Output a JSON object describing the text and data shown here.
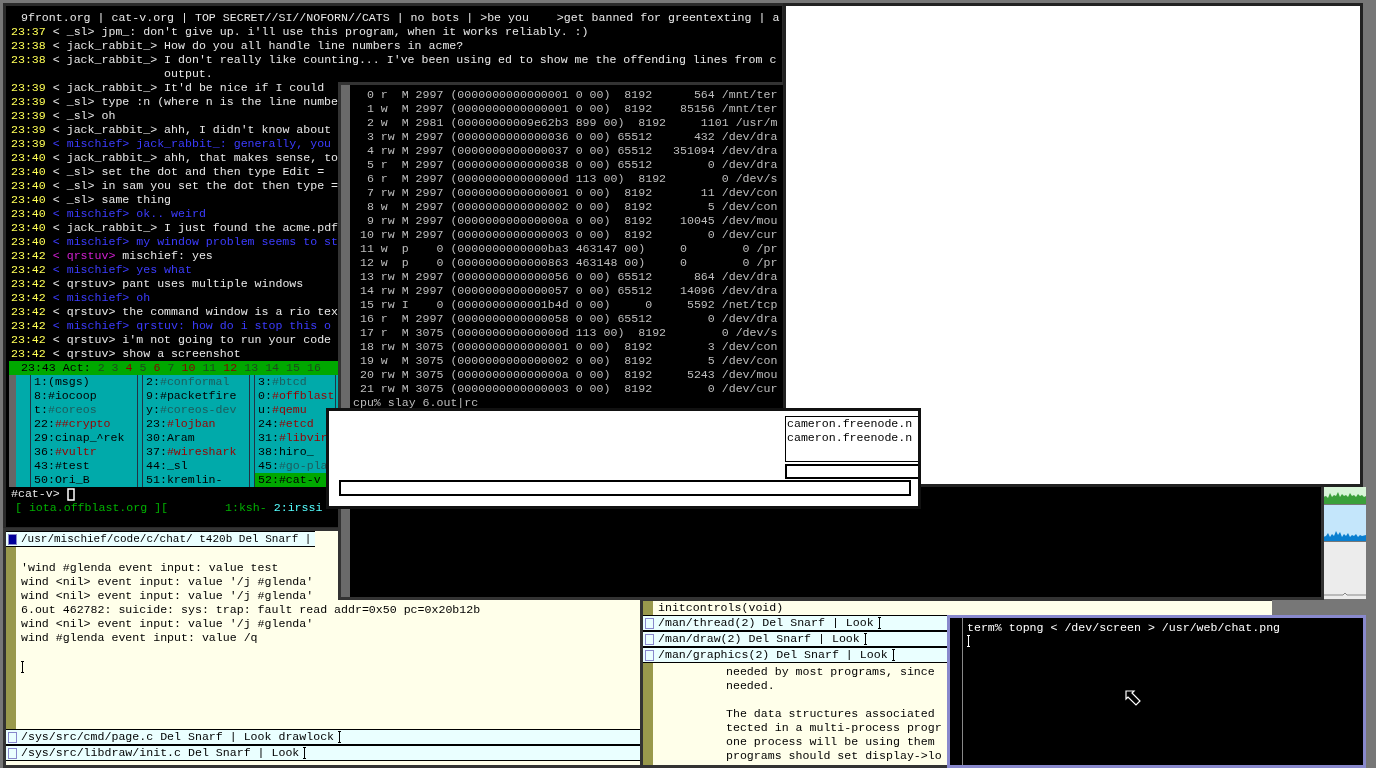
{
  "irc": {
    "topic": "9front.org | cat-v.org | TOP SECRET//SI//NOFORN//CATS | no bots | >be you    >get banned for greentexting | a",
    "lines": [
      {
        "kind": "normal",
        "time": "23:37",
        "nick": "< _sl>",
        "text": "jpm_: don't give up. i'll use this program, when it works reliably. :)"
      },
      {
        "kind": "normal",
        "time": "23:38",
        "nick": "< jack_rabbit_>",
        "text": "How do you all handle line numbers in acme?"
      },
      {
        "kind": "normal",
        "time": "23:38",
        "nick": "< jack_rabbit_>",
        "text": "I don't really like counting... I've been using ed to show me the offending lines from c"
      },
      {
        "kind": "wrap",
        "text": "output."
      },
      {
        "kind": "normal",
        "time": "23:39",
        "nick": "< jack_rabbit_>",
        "text": "It'd be nice if I could"
      },
      {
        "kind": "normal",
        "time": "23:39",
        "nick": "< _sl>",
        "text": "type :n (where n is the line numbe"
      },
      {
        "kind": "normal",
        "time": "23:39",
        "nick": "< _sl>",
        "text": "oh"
      },
      {
        "kind": "normal",
        "time": "23:39",
        "nick": "< jack_rabbit_>",
        "text": "ahh, I didn't know about"
      },
      {
        "kind": "own",
        "time": "23:39",
        "nick": "< mischief>",
        "text": "jack_rabbit_: generally, you"
      },
      {
        "kind": "normal",
        "time": "23:40",
        "nick": "< jack_rabbit_>",
        "text": "ahh, that makes sense, to"
      },
      {
        "kind": "normal",
        "time": "23:40",
        "nick": "< _sl>",
        "text": "set the dot and then type Edit ="
      },
      {
        "kind": "normal",
        "time": "23:40",
        "nick": "< _sl>",
        "text": "in sam you set the dot then type ="
      },
      {
        "kind": "normal",
        "time": "23:40",
        "nick": "< _sl>",
        "text": "same thing"
      },
      {
        "kind": "own",
        "time": "23:40",
        "nick": "< mischief>",
        "text": "ok.. weird"
      },
      {
        "kind": "normal",
        "time": "23:40",
        "nick": "< jack_rabbit_>",
        "text": "I just found the acme.pdf"
      },
      {
        "kind": "own",
        "time": "23:40",
        "nick": "< mischief>",
        "text": "my window problem seems to st"
      },
      {
        "kind": "mention",
        "time": "23:42",
        "nick": "< qrstuv>",
        "text": "mischief: yes"
      },
      {
        "kind": "own",
        "time": "23:42",
        "nick": "< mischief>",
        "text": "yes what"
      },
      {
        "kind": "normal",
        "time": "23:42",
        "nick": "< qrstuv>",
        "text": "pant uses multiple windows"
      },
      {
        "kind": "own",
        "time": "23:42",
        "nick": "< mischief>",
        "text": "oh"
      },
      {
        "kind": "normal",
        "time": "23:42",
        "nick": "< qrstuv>",
        "text": "the command window is a rio tex"
      },
      {
        "kind": "own",
        "time": "23:42",
        "nick": "< mischief>",
        "text": "qrstuv: how do i stop this o"
      },
      {
        "kind": "normal",
        "time": "23:42",
        "nick": "< qrstuv>",
        "text": "i'm not going to run your code"
      },
      {
        "kind": "normal",
        "time": "23:42",
        "nick": "< qrstuv>",
        "text": "show a screenshot"
      }
    ],
    "status": {
      "clock": "23:43",
      "label": "Act:",
      "activity": [
        {
          "label": "2",
          "alert": false
        },
        {
          "label": "3",
          "alert": false
        },
        {
          "label": "4",
          "alert": true
        },
        {
          "label": "5",
          "alert": false
        },
        {
          "label": "6",
          "alert": true
        },
        {
          "label": "7",
          "alert": false
        },
        {
          "label": "10",
          "alert": true
        },
        {
          "label": "11",
          "alert": false
        },
        {
          "label": "12",
          "alert": true
        },
        {
          "label": "13",
          "alert": false
        },
        {
          "label": "14",
          "alert": false
        },
        {
          "label": "15",
          "alert": false
        },
        {
          "label": "16",
          "alert": false
        }
      ]
    },
    "windows": [
      {
        "num": "1:",
        "name": "(msgs)",
        "kind": "plain",
        "selected": false
      },
      {
        "num": "2:",
        "name": "#conformal",
        "kind": "dim",
        "selected": false
      },
      {
        "num": "3:",
        "name": "#btcd",
        "kind": "dim",
        "selected": false
      },
      {
        "num": "8:",
        "name": "#iocoop",
        "kind": "plain",
        "selected": false
      },
      {
        "num": "9:",
        "name": "#packetfire",
        "kind": "plain",
        "selected": false
      },
      {
        "num": "0:",
        "name": "#offblast",
        "kind": "alert",
        "selected": false
      },
      {
        "num": "t:",
        "name": "#coreos",
        "kind": "dim",
        "selected": false
      },
      {
        "num": "y:",
        "name": "#coreos-dev",
        "kind": "dim",
        "selected": false
      },
      {
        "num": "u:",
        "name": "#qemu",
        "kind": "alert",
        "selected": false
      },
      {
        "num": "22:",
        "name": "##crypto",
        "kind": "alert",
        "selected": false
      },
      {
        "num": "23:",
        "name": "#lojban",
        "kind": "alert",
        "selected": false
      },
      {
        "num": "24:",
        "name": "#etcd",
        "kind": "alert",
        "selected": false
      },
      {
        "num": "29:",
        "name": "cinap_^rek",
        "kind": "plain",
        "selected": false
      },
      {
        "num": "30:",
        "name": "Aram",
        "kind": "plain",
        "selected": false
      },
      {
        "num": "31:",
        "name": "#libvir",
        "kind": "alert",
        "selected": false
      },
      {
        "num": "36:",
        "name": "#vultr",
        "kind": "alert",
        "selected": false
      },
      {
        "num": "37:",
        "name": "#wireshark",
        "kind": "alert",
        "selected": false
      },
      {
        "num": "38:",
        "name": "hiro_",
        "kind": "plain",
        "selected": false
      },
      {
        "num": "43:",
        "name": "#test",
        "kind": "plain",
        "selected": false
      },
      {
        "num": "44:",
        "name": "_sl",
        "kind": "plain",
        "selected": false
      },
      {
        "num": "45:",
        "name": "#go-pla",
        "kind": "dim",
        "selected": false
      },
      {
        "num": "50:",
        "name": "Ori_B",
        "kind": "plain",
        "selected": false
      },
      {
        "num": "51:",
        "name": "kremlin-",
        "kind": "plain",
        "selected": false
      },
      {
        "num": "52:",
        "name": "#cat-v",
        "kind": "plain",
        "selected": true
      }
    ],
    "prompt": "#cat-v>",
    "session": "[ iota.offblast.org ][",
    "tabs": [
      {
        "label": "1:ksh-",
        "selected": false
      },
      {
        "label": "2:irssi",
        "selected": true
      }
    ]
  },
  "fd_listing": {
    "rows": [
      "  0 r  M 2997 (0000000000000001 0 00)  8192      564 /mnt/ter",
      "  1 w  M 2997 (0000000000000001 0 00)  8192    85156 /mnt/ter",
      "  2 w  M 2981 (00000000009e62b3 899 00)  8192     1101 /usr/m",
      "  3 rw M 2997 (0000000000000036 0 00) 65512      432 /dev/dra",
      "  4 rw M 2997 (0000000000000037 0 00) 65512   351094 /dev/dra",
      "  5 r  M 2997 (0000000000000038 0 00) 65512        0 /dev/dra",
      "  6 r  M 2997 (000000000000000d 113 00)  8192        0 /dev/s",
      "  7 rw M 2997 (0000000000000001 0 00)  8192       11 /dev/con",
      "  8 w  M 2997 (0000000000000002 0 00)  8192        5 /dev/con",
      "  9 rw M 2997 (000000000000000a 0 00)  8192    10045 /dev/mou",
      " 10 rw M 2997 (0000000000000003 0 00)  8192        0 /dev/cur",
      " 11 w  p    0 (0000000000000ba3 463147 00)     0        0 /pr",
      " 12 w  p    0 (0000000000000863 463148 00)     0        0 /pr",
      " 13 rw M 2997 (0000000000000056 0 00) 65512      864 /dev/dra",
      " 14 rw M 2997 (0000000000000057 0 00) 65512    14096 /dev/dra",
      " 15 rw I    0 (0000000000001b4d 0 00)     0     5592 /net/tcp",
      " 16 r  M 2997 (0000000000000058 0 00) 65512        0 /dev/dra",
      " 17 r  M 3075 (000000000000000d 113 00)  8192        0 /dev/s",
      " 18 rw M 3075 (0000000000000001 0 00)  8192        3 /dev/con",
      " 19 w  M 3075 (0000000000000002 0 00)  8192        5 /dev/con",
      " 20 rw M 3075 (000000000000000a 0 00)  8192     5243 /dev/mou",
      " 21 rw M 3075 (0000000000000003 0 00)  8192        0 /dev/cur"
    ],
    "prompt": "cpu% slay 6.out|rc"
  },
  "dialog": {
    "entries": [
      "cameron.freenode.n",
      "cameron.freenode.n"
    ]
  },
  "acme_left": {
    "tag": "/usr/mischief/code/c/chat/ t420b Del Snarf |",
    "body": [
      "'wind #glenda event input: value test",
      "wind <nil> event input: value '/j #glenda'",
      "wind <nil> event input: value '/j #glenda'",
      "6.out 462782: suicide: sys: trap: fault read addr=0x50 pc=0x20b12b",
      "wind <nil> event input: value '/j #glenda'",
      "wind #glenda event input: value /q"
    ],
    "tags": [
      "/sys/src/cmd/page.c Del Snarf | Look drawlock",
      "/sys/src/libdraw/init.c Del Snarf | Look"
    ]
  },
  "acme_right": {
    "top_line": "initcontrols(void)",
    "tags": [
      "/man/thread(2) Del Snarf | Look",
      "/man/draw(2) Del Snarf | Look",
      "/man/graphics(2) Del Snarf | Look"
    ],
    "body": [
      [
        "needed by most programs, since",
        "needed."
      ],
      [
        "The data structures associated",
        "tected in a multi-process progr",
        "one process will be using them",
        "programs should set display->lo"
      ]
    ]
  },
  "term": {
    "lines": [
      "term% topng < /dev/screen > /usr/web/chat.png"
    ]
  }
}
